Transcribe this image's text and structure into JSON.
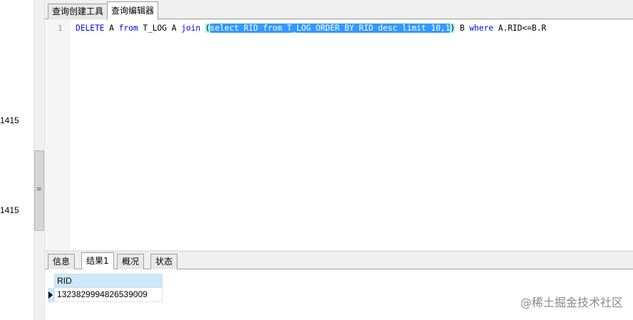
{
  "left_panel": {
    "numbers": [
      "1415",
      "1415"
    ]
  },
  "tabs": {
    "items": [
      "查询创建工具",
      "查询编辑器"
    ],
    "active_index": 1
  },
  "editor": {
    "line_number": "1",
    "code": {
      "kw_delete": "DELETE",
      "t1": " A ",
      "kw_from": "from",
      "t2": " T_LOG A ",
      "kw_join": "join",
      "t3": " ",
      "open_paren": "(",
      "selected": "select RID from T_LOG ORDER BY RID desc limit 10,1",
      "close_paren": ")",
      "t4": " B ",
      "kw_where": "where",
      "t5": " A.RID<=B.R"
    }
  },
  "result_tabs": {
    "items": [
      "信息",
      "结果1",
      "概况",
      "状态"
    ],
    "active_index": 1
  },
  "grid": {
    "columns": [
      "RID"
    ],
    "rows": [
      [
        "1323829994826539009"
      ]
    ]
  },
  "watermark": "@稀土掘金技术社区",
  "colors": {
    "selection": "#3399ff",
    "keyword": "#0000ff",
    "grid_header": "#cde8f7"
  }
}
